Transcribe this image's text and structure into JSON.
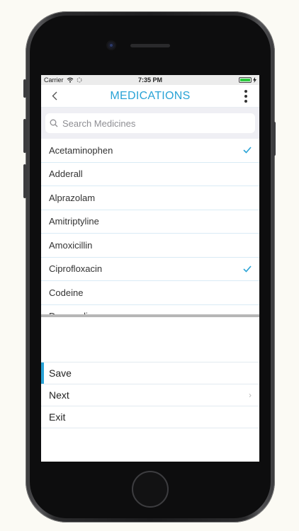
{
  "status_bar": {
    "carrier": "Carrier",
    "time": "7:35 PM",
    "battery_color": "#2ecc40"
  },
  "header": {
    "title": "MEDICATIONS",
    "back_icon": "chevron-left-icon",
    "more_icon": "more-vertical-icon"
  },
  "search": {
    "placeholder": "Search Medicines",
    "icon": "search-icon"
  },
  "medications": [
    {
      "name": "Acetaminophen",
      "checked": true
    },
    {
      "name": "Adderall",
      "checked": false
    },
    {
      "name": "Alprazolam",
      "checked": false
    },
    {
      "name": "Amitriptyline",
      "checked": false
    },
    {
      "name": "Amoxicillin",
      "checked": false
    },
    {
      "name": "Ciprofloxacin",
      "checked": true
    },
    {
      "name": "Codeine",
      "checked": false
    },
    {
      "name": "Doxycycline",
      "checked": false
    }
  ],
  "menu": [
    {
      "label": "Save",
      "active": true,
      "chevron": false
    },
    {
      "label": "Next",
      "active": false,
      "chevron": true
    },
    {
      "label": "Exit",
      "active": false,
      "chevron": false
    }
  ],
  "colors": {
    "accent": "#29a3d6",
    "row_divider": "#d9ebf5"
  }
}
